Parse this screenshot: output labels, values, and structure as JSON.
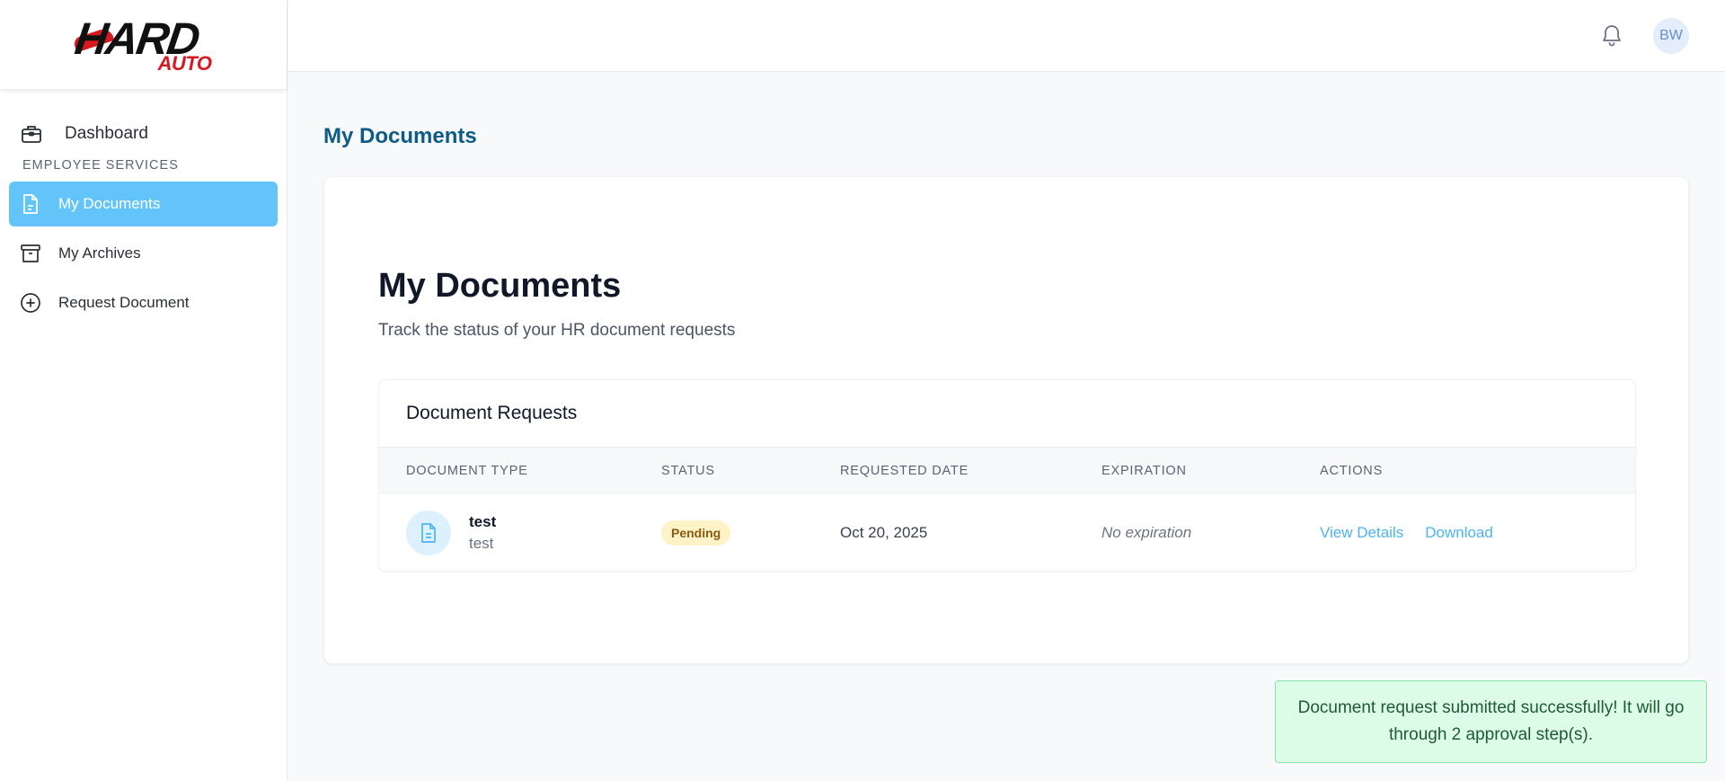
{
  "brand": {
    "logo_text_main": "HARD",
    "logo_text_sub": "AUTO"
  },
  "sidebar": {
    "dashboard": {
      "label": "Dashboard",
      "icon": "briefcase-icon"
    },
    "section_label": "EMPLOYEE SERVICES",
    "items": [
      {
        "label": "My Documents",
        "icon": "document-icon",
        "active": true
      },
      {
        "label": "My Archives",
        "icon": "archive-icon",
        "active": false
      },
      {
        "label": "Request Document",
        "icon": "plus-circle-icon",
        "active": false
      }
    ]
  },
  "topbar": {
    "notification_icon": "bell-icon",
    "avatar_initials": "BW"
  },
  "main": {
    "page_title": "My Documents",
    "card_title": "My Documents",
    "card_subtitle": "Track the status of your HR document requests",
    "table": {
      "heading": "Document Requests",
      "columns": [
        "DOCUMENT TYPE",
        "STATUS",
        "REQUESTED DATE",
        "EXPIRATION",
        "ACTIONS"
      ],
      "rows": [
        {
          "name": "test",
          "description": "test",
          "status": "Pending",
          "requested_date": "Oct 20, 2025",
          "expiration": "No expiration",
          "actions": [
            "View Details",
            "Download"
          ]
        }
      ]
    }
  },
  "toast": {
    "message": "Document request submitted successfully! It will go through 2 approval step(s)."
  },
  "colors": {
    "accent": "#63c4f9",
    "title": "#0d5c86",
    "link": "#4db4f2",
    "pending_bg": "#fdf3c7",
    "toast_bg": "#dcfce7"
  }
}
